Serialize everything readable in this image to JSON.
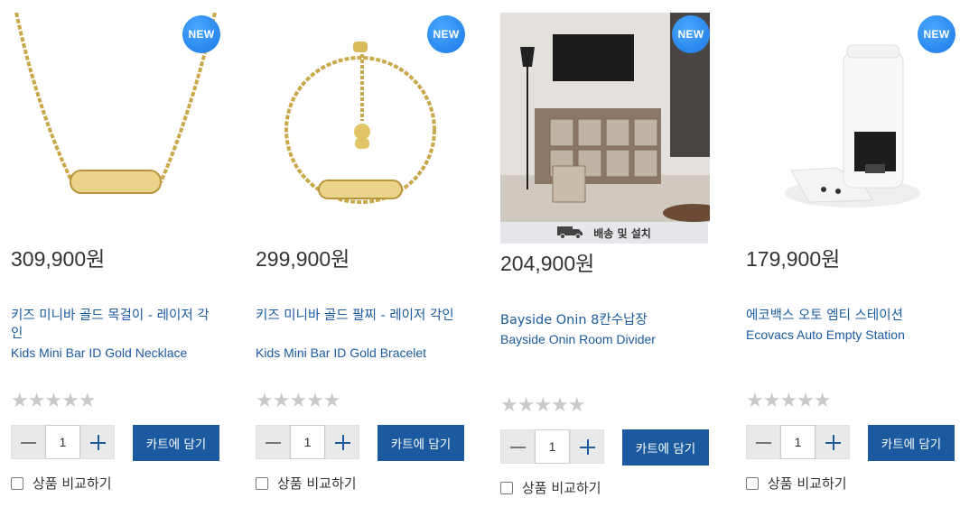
{
  "badge": "NEW",
  "delivery_label": "배송 및 설치",
  "cart_label": "카트에 담기",
  "compare_label": "상품 비교하기",
  "stars": "★★★★★",
  "products": [
    {
      "price": "309,900원",
      "name_ko": "키즈 미니바 골드 목걸이 - 레이저 각인",
      "name_en": "Kids Mini Bar ID Gold Necklace",
      "qty": "1",
      "rating": 0,
      "image": "gold-necklace-image"
    },
    {
      "price": "299,900원",
      "name_ko": "키즈 미니바 골드 팔찌 - 레이저 각인",
      "name_en": "Kids Mini Bar ID Gold Bracelet",
      "qty": "1",
      "rating": 0,
      "image": "gold-bracelet-image"
    },
    {
      "price": "204,900원",
      "name_ko": "Bayside Onin 8칸수납장",
      "name_en": "Bayside Onin Room Divider",
      "qty": "1",
      "rating": 0,
      "image": "room-divider-image",
      "delivery": true
    },
    {
      "price": "179,900원",
      "name_ko": "에코백스 오토 엠티 스테이션",
      "name_en": "Ecovacs Auto Empty Station",
      "qty": "1",
      "rating": 0,
      "image": "auto-empty-station-image"
    }
  ],
  "colors": {
    "link": "#1b5a9e",
    "badge": "#1a78e6",
    "button": "#1b5a9e",
    "star_empty": "#c9c9c9"
  }
}
